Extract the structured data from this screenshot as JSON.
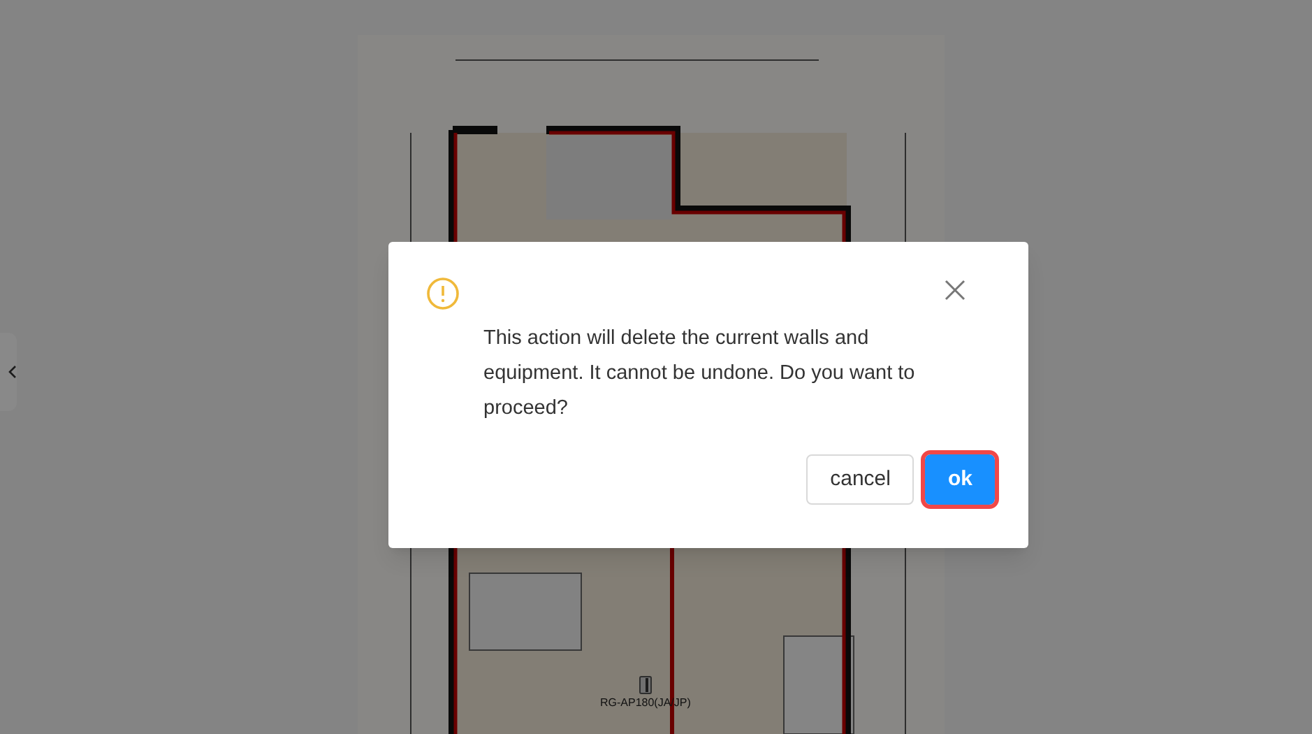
{
  "canvas": {
    "kind": "picture",
    "equipment": [
      {
        "label": "RG-AP180(JA/JP)"
      }
    ]
  },
  "dialog": {
    "message": "This action will delete the current walls and equipment. It cannot be undone. Do you want to proceed?",
    "buttons": [
      {
        "label": "cancel",
        "kind": "secondary",
        "focused": false
      },
      {
        "label": "ok",
        "kind": "primary",
        "focused": true
      }
    ]
  }
}
